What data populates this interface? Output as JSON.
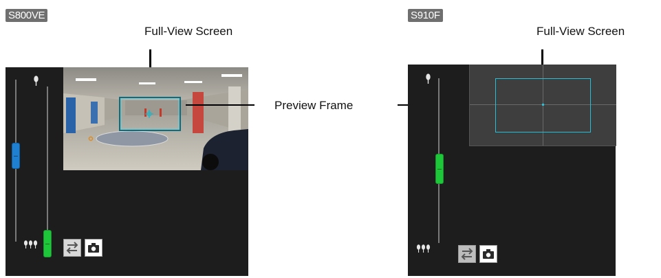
{
  "left": {
    "model_label": "S800VE",
    "full_view_label": "Full-View Screen"
  },
  "right": {
    "model_label": "S910F",
    "full_view_label": "Full-View Screen"
  },
  "preview_frame_label": "Preview Frame",
  "colors": {
    "panel": "#1d1d1d",
    "zoom_slider": "#1f7fd0",
    "focus_slider": "#1ec63a",
    "preview_frame": "#27c0d8"
  },
  "icons": {
    "near_focus": "single-tree-icon",
    "far_focus": "three-trees-icon",
    "swap": "swap-arrows-icon",
    "snapshot": "camera-icon"
  }
}
